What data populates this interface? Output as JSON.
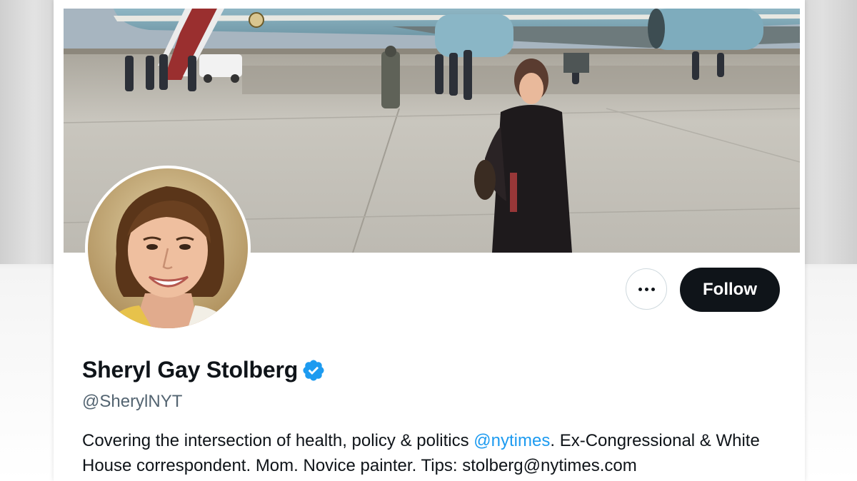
{
  "profile": {
    "display_name": "Sheryl Gay Stolberg",
    "handle": "@SherylNYT",
    "verified_icon": "verified-badge-icon",
    "bio": {
      "part1": "Covering the intersection of health, policy & politics ",
      "mention": "@nytimes",
      "part2": ". Ex-Congressional & White House correspondent. Mom. Novice painter. Tips: stolberg@nytimes.com"
    }
  },
  "actions": {
    "more_icon": "more-options-icon",
    "follow_label": "Follow"
  },
  "colors": {
    "accent": "#1d9bf0",
    "follow_bg": "#0f1419",
    "text": "#0f1419",
    "secondary_text": "#536471"
  }
}
